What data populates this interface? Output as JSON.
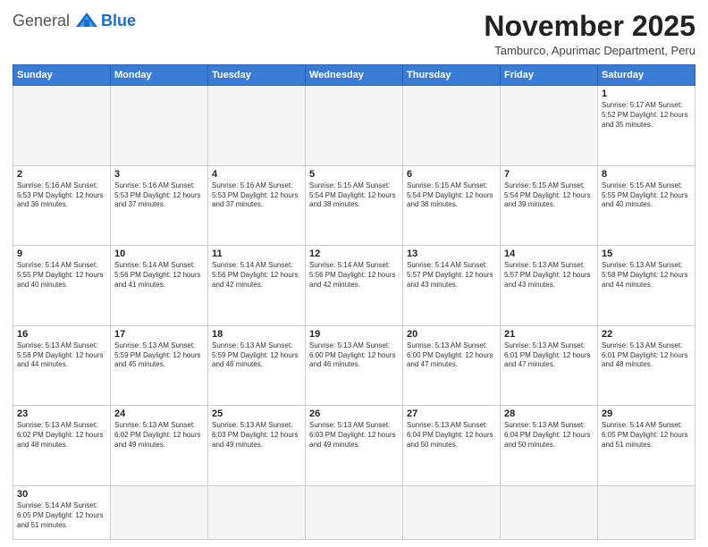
{
  "logo": {
    "general": "General",
    "blue": "Blue"
  },
  "header": {
    "month": "November 2025",
    "location": "Tamburco, Apurimac Department, Peru"
  },
  "weekdays": [
    "Sunday",
    "Monday",
    "Tuesday",
    "Wednesday",
    "Thursday",
    "Friday",
    "Saturday"
  ],
  "weeks": [
    [
      {
        "day": "",
        "info": ""
      },
      {
        "day": "",
        "info": ""
      },
      {
        "day": "",
        "info": ""
      },
      {
        "day": "",
        "info": ""
      },
      {
        "day": "",
        "info": ""
      },
      {
        "day": "",
        "info": ""
      },
      {
        "day": "1",
        "info": "Sunrise: 5:17 AM\nSunset: 5:52 PM\nDaylight: 12 hours and 35 minutes."
      }
    ],
    [
      {
        "day": "2",
        "info": "Sunrise: 5:16 AM\nSunset: 5:53 PM\nDaylight: 12 hours and 36 minutes."
      },
      {
        "day": "3",
        "info": "Sunrise: 5:16 AM\nSunset: 5:53 PM\nDaylight: 12 hours and 37 minutes."
      },
      {
        "day": "4",
        "info": "Sunrise: 5:16 AM\nSunset: 5:53 PM\nDaylight: 12 hours and 37 minutes."
      },
      {
        "day": "5",
        "info": "Sunrise: 5:15 AM\nSunset: 5:54 PM\nDaylight: 12 hours and 38 minutes."
      },
      {
        "day": "6",
        "info": "Sunrise: 5:15 AM\nSunset: 5:54 PM\nDaylight: 12 hours and 38 minutes."
      },
      {
        "day": "7",
        "info": "Sunrise: 5:15 AM\nSunset: 5:54 PM\nDaylight: 12 hours and 39 minutes."
      },
      {
        "day": "8",
        "info": "Sunrise: 5:15 AM\nSunset: 5:55 PM\nDaylight: 12 hours and 40 minutes."
      }
    ],
    [
      {
        "day": "9",
        "info": "Sunrise: 5:14 AM\nSunset: 5:55 PM\nDaylight: 12 hours and 40 minutes."
      },
      {
        "day": "10",
        "info": "Sunrise: 5:14 AM\nSunset: 5:56 PM\nDaylight: 12 hours and 41 minutes."
      },
      {
        "day": "11",
        "info": "Sunrise: 5:14 AM\nSunset: 5:56 PM\nDaylight: 12 hours and 42 minutes."
      },
      {
        "day": "12",
        "info": "Sunrise: 5:14 AM\nSunset: 5:56 PM\nDaylight: 12 hours and 42 minutes."
      },
      {
        "day": "13",
        "info": "Sunrise: 5:14 AM\nSunset: 5:57 PM\nDaylight: 12 hours and 43 minutes."
      },
      {
        "day": "14",
        "info": "Sunrise: 5:13 AM\nSunset: 5:57 PM\nDaylight: 12 hours and 43 minutes."
      },
      {
        "day": "15",
        "info": "Sunrise: 5:13 AM\nSunset: 5:58 PM\nDaylight: 12 hours and 44 minutes."
      }
    ],
    [
      {
        "day": "16",
        "info": "Sunrise: 5:13 AM\nSunset: 5:58 PM\nDaylight: 12 hours and 44 minutes."
      },
      {
        "day": "17",
        "info": "Sunrise: 5:13 AM\nSunset: 5:59 PM\nDaylight: 12 hours and 45 minutes."
      },
      {
        "day": "18",
        "info": "Sunrise: 5:13 AM\nSunset: 5:59 PM\nDaylight: 12 hours and 46 minutes."
      },
      {
        "day": "19",
        "info": "Sunrise: 5:13 AM\nSunset: 6:00 PM\nDaylight: 12 hours and 46 minutes."
      },
      {
        "day": "20",
        "info": "Sunrise: 5:13 AM\nSunset: 6:00 PM\nDaylight: 12 hours and 47 minutes."
      },
      {
        "day": "21",
        "info": "Sunrise: 5:13 AM\nSunset: 6:01 PM\nDaylight: 12 hours and 47 minutes."
      },
      {
        "day": "22",
        "info": "Sunrise: 5:13 AM\nSunset: 6:01 PM\nDaylight: 12 hours and 48 minutes."
      }
    ],
    [
      {
        "day": "23",
        "info": "Sunrise: 5:13 AM\nSunset: 6:02 PM\nDaylight: 12 hours and 48 minutes."
      },
      {
        "day": "24",
        "info": "Sunrise: 5:13 AM\nSunset: 6:02 PM\nDaylight: 12 hours and 49 minutes."
      },
      {
        "day": "25",
        "info": "Sunrise: 5:13 AM\nSunset: 6:03 PM\nDaylight: 12 hours and 49 minutes."
      },
      {
        "day": "26",
        "info": "Sunrise: 5:13 AM\nSunset: 6:03 PM\nDaylight: 12 hours and 49 minutes."
      },
      {
        "day": "27",
        "info": "Sunrise: 5:13 AM\nSunset: 6:04 PM\nDaylight: 12 hours and 50 minutes."
      },
      {
        "day": "28",
        "info": "Sunrise: 5:13 AM\nSunset: 6:04 PM\nDaylight: 12 hours and 50 minutes."
      },
      {
        "day": "29",
        "info": "Sunrise: 5:14 AM\nSunset: 6:05 PM\nDaylight: 12 hours and 51 minutes."
      }
    ],
    [
      {
        "day": "30",
        "info": "Sunrise: 5:14 AM\nSunset: 6:05 PM\nDaylight: 12 hours and 51 minutes."
      },
      {
        "day": "",
        "info": ""
      },
      {
        "day": "",
        "info": ""
      },
      {
        "day": "",
        "info": ""
      },
      {
        "day": "",
        "info": ""
      },
      {
        "day": "",
        "info": ""
      },
      {
        "day": "",
        "info": ""
      }
    ]
  ]
}
